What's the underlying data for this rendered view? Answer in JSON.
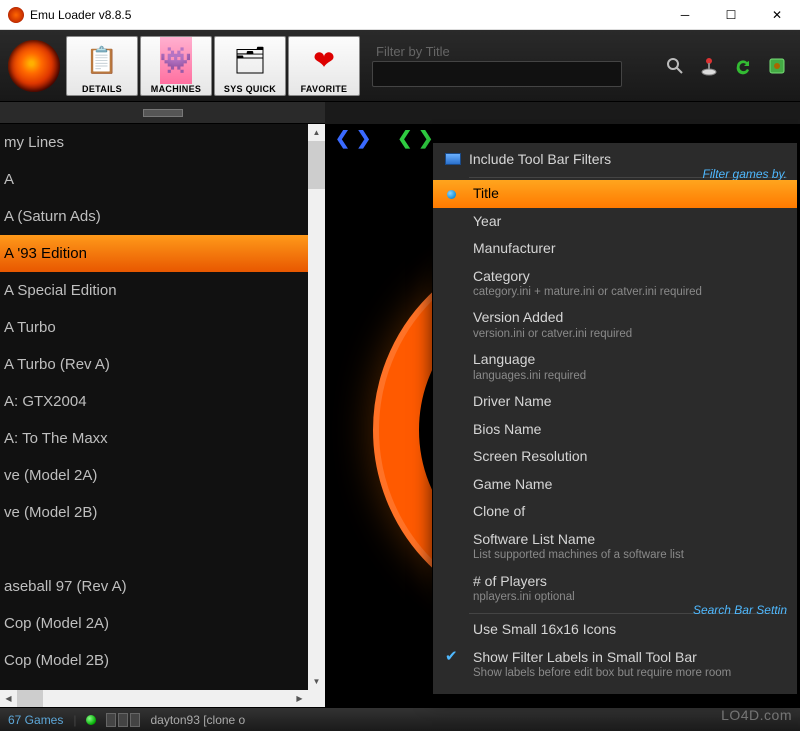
{
  "window": {
    "title": "Emu Loader v8.8.5"
  },
  "toolbar": {
    "buttons": [
      {
        "label": "DETAILS",
        "glyph": "📋"
      },
      {
        "label": "MACHINES",
        "glyph": "👾"
      },
      {
        "label": "SYS QUICK",
        "glyph": "🗂"
      },
      {
        "label": "FAVORITE",
        "glyph": "❤"
      }
    ],
    "filter_label": "Filter by Title",
    "filter_value": ""
  },
  "games": {
    "items": [
      "my Lines",
      "A",
      "A (Saturn Ads)",
      "A '93 Edition",
      "A Special Edition",
      "A Turbo",
      "A Turbo (Rev A)",
      "A: GTX2004",
      "A: To The Maxx",
      "ve (Model 2A)",
      "ve (Model 2B)",
      "",
      "aseball 97 (Rev A)",
      "Cop (Model 2A)",
      "Cop (Model 2B)"
    ],
    "selected_index": 3
  },
  "menu": {
    "header": "Include Tool Bar Filters",
    "section1_caption": "Filter games by.",
    "section2_caption": "Search Bar Settin",
    "filters": [
      {
        "label": "Title",
        "sub": "",
        "selected": true
      },
      {
        "label": "Year"
      },
      {
        "label": "Manufacturer"
      },
      {
        "label": "Category",
        "sub": "category.ini + mature.ini or catver.ini required"
      },
      {
        "label": "Version Added",
        "sub": "version.ini or catver.ini required"
      },
      {
        "label": "Language",
        "sub": "languages.ini required"
      },
      {
        "label": "Driver Name"
      },
      {
        "label": "Bios Name"
      },
      {
        "label": "Screen Resolution"
      },
      {
        "label": "Game Name"
      },
      {
        "label": "Clone of"
      },
      {
        "label": "Software List Name",
        "sub": "List supported machines of a software list"
      },
      {
        "label": "# of Players",
        "sub": "nplayers.ini optional"
      }
    ],
    "settings": [
      {
        "label": "Use Small 16x16 Icons",
        "checked": false
      },
      {
        "label": "Show Filter Labels in Small Tool Bar",
        "sub": "Show labels before edit box but require more room",
        "checked": true
      }
    ]
  },
  "status": {
    "count": "67 Games",
    "rom": "dayton93 [clone o"
  },
  "watermark": "LO4D.com"
}
